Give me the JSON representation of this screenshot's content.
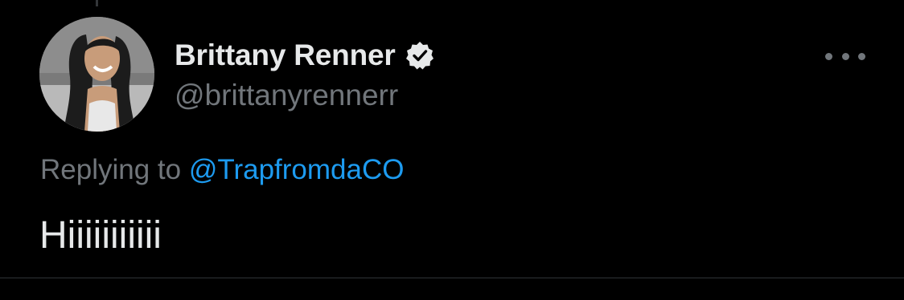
{
  "tweet": {
    "author": {
      "display_name": "Brittany Renner",
      "handle": "@brittanyrennerr",
      "verified": true,
      "avatar": "profile-photo"
    },
    "replying_to": {
      "prefix": "Replying to",
      "mention": "@TrapfromdaCO"
    },
    "text": "Hiiiiiiiiiii",
    "more_icon": "more-horizontal-icon"
  },
  "colors": {
    "background": "#000000",
    "primary_text": "#e7e9ea",
    "secondary_text": "#71767b",
    "link": "#1d9bf0",
    "divider": "#2f3336"
  }
}
